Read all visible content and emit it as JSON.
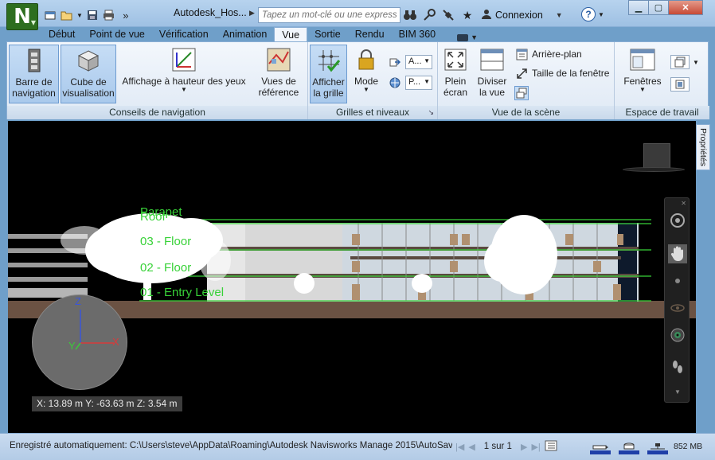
{
  "app": {
    "logo_letter": "N",
    "document_title": "Autodesk_Hos...",
    "search_placeholder": "Tapez un mot-clé ou une expression",
    "signin_label": "Connexion",
    "help_label": "?"
  },
  "quick_access": [
    "new-icon",
    "open-icon",
    "save-icon",
    "print-icon",
    "more-icon"
  ],
  "title_icons": [
    "binoculars-icon",
    "key-icon",
    "satellite-icon",
    "star-icon"
  ],
  "window_controls": [
    "minimize-icon",
    "restore-icon",
    "close-icon"
  ],
  "tabs": [
    {
      "label": "Début",
      "active": false
    },
    {
      "label": "Point de vue",
      "active": false
    },
    {
      "label": "Vérification",
      "active": false
    },
    {
      "label": "Animation",
      "active": false
    },
    {
      "label": "Vue",
      "active": true
    },
    {
      "label": "Sortie",
      "active": false
    },
    {
      "label": "Rendu",
      "active": false
    },
    {
      "label": "BIM 360",
      "active": false
    }
  ],
  "ribbon": {
    "nav_aids": {
      "group_label": "Conseils de navigation",
      "nav_bar": {
        "line1": "Barre de",
        "line2": "navigation"
      },
      "view_cube": {
        "line1": "Cube de",
        "line2": "visualisation"
      },
      "hud": {
        "line1": "Affichage à hauteur des yeux"
      },
      "ref_views": {
        "line1": "Vues de",
        "line2": "référence"
      }
    },
    "grids": {
      "group_label": "Grilles et niveaux",
      "show_grid": {
        "line1": "Afficher",
        "line2": "la grille"
      },
      "mode": {
        "line1": "Mode"
      },
      "combo1_value": "A...",
      "combo2_value": "P..."
    },
    "scene_view": {
      "group_label": "Vue de la scène",
      "fullscreen": {
        "line1": "Plein",
        "line2": "écran"
      },
      "split_view": {
        "line1": "Diviser",
        "line2": "la vue"
      },
      "background": "Arrière-plan",
      "window_size": "Taille de la fenêtre"
    },
    "workspace": {
      "group_label": "Espace de travail",
      "windows": {
        "line1": "Fenêtres"
      }
    }
  },
  "scene": {
    "levels": [
      "Parapet",
      "Roof",
      "03 - Floor",
      "02 - Floor",
      "01 - Entry Level"
    ],
    "axis_labels": {
      "x": "X",
      "y": "Y",
      "z": "Z"
    },
    "coordinates": "X: 13.89 m  Y: -63.63 m  Z: 3.54 m",
    "properties_tab": "Propriétés",
    "colors": {
      "level_line": "#38d238",
      "ground": "#6b5243",
      "background": "#000000"
    }
  },
  "status": {
    "autosave_text": "Enregistré automatiquement: C:\\Users\\steve\\AppData\\Roaming\\Autodesk Navisworks Manage 2015\\AutoSave\\j...",
    "page_text": "1 sur 1",
    "memory": "852 MB"
  }
}
